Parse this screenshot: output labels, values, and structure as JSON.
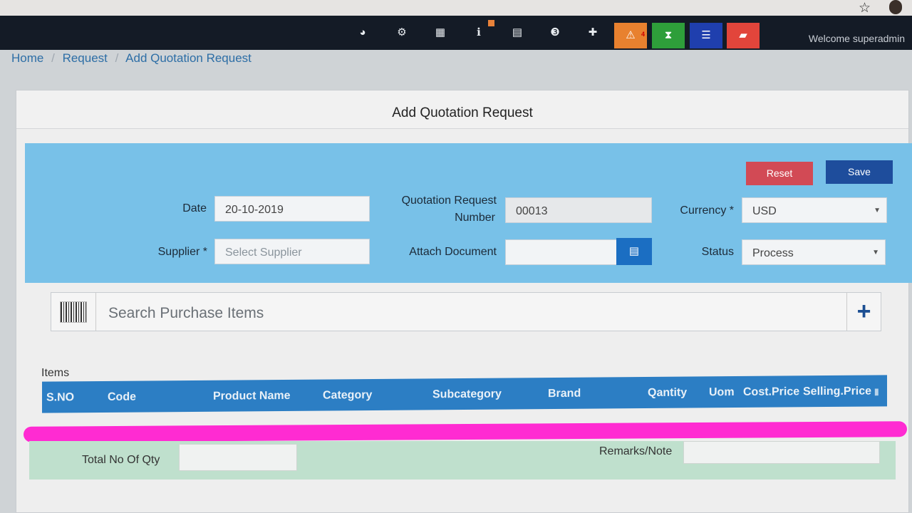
{
  "header": {
    "icons": [
      "dashboard-icon",
      "settings-icon",
      "calculator-icon",
      "info-icon",
      "calendar-icon",
      "css-icon",
      "uk-flag-icon"
    ],
    "tiles": [
      {
        "name": "alert-icon",
        "color": "#e8812f",
        "badge": "4"
      },
      {
        "name": "hourglass-icon",
        "color": "#2e9e3a",
        "badge": ""
      },
      {
        "name": "list-icon",
        "color": "#1f3fae",
        "badge": ""
      },
      {
        "name": "eraser-icon",
        "color": "#e2453b",
        "badge": ""
      }
    ],
    "welcome": "Welcome superadmin"
  },
  "breadcrumb": {
    "home": "Home",
    "request": "Request",
    "current": "Add Quotation Request",
    "separator": "/"
  },
  "page": {
    "title": "Add Quotation Request"
  },
  "buttons": {
    "reset": "Reset",
    "save": "Save"
  },
  "form": {
    "date_label": "Date",
    "date_value": "20-10-2019",
    "qr_label_line1": "Quotation Request",
    "qr_label_line2": "Number",
    "qr_value": "00013",
    "currency_label": "Currency *",
    "currency_value": "USD",
    "supplier_label": "Supplier *",
    "supplier_placeholder": "Select  Supplier",
    "attach_label": "Attach Document",
    "status_label": "Status",
    "status_value": "Process"
  },
  "search": {
    "placeholder": "Search Purchase Items"
  },
  "items": {
    "label": "Items",
    "columns": [
      "S.NO",
      "Code",
      "Product Name",
      "Category",
      "Subcategory",
      "Brand",
      "Qantity",
      "Uom",
      "Cost.Price",
      "Selling.Price"
    ]
  },
  "totals": {
    "qty_label": "Total No Of Qty",
    "remarks_label": "Remarks/Note"
  },
  "colors": {
    "topbar": "#141b26",
    "form_bg": "#78c1e8",
    "table_header": "#2c7ec4",
    "reset": "#d24a55",
    "save": "#1e4d9c",
    "marker": "#ff2bd2",
    "totals_bg": "#bfe0cd"
  }
}
